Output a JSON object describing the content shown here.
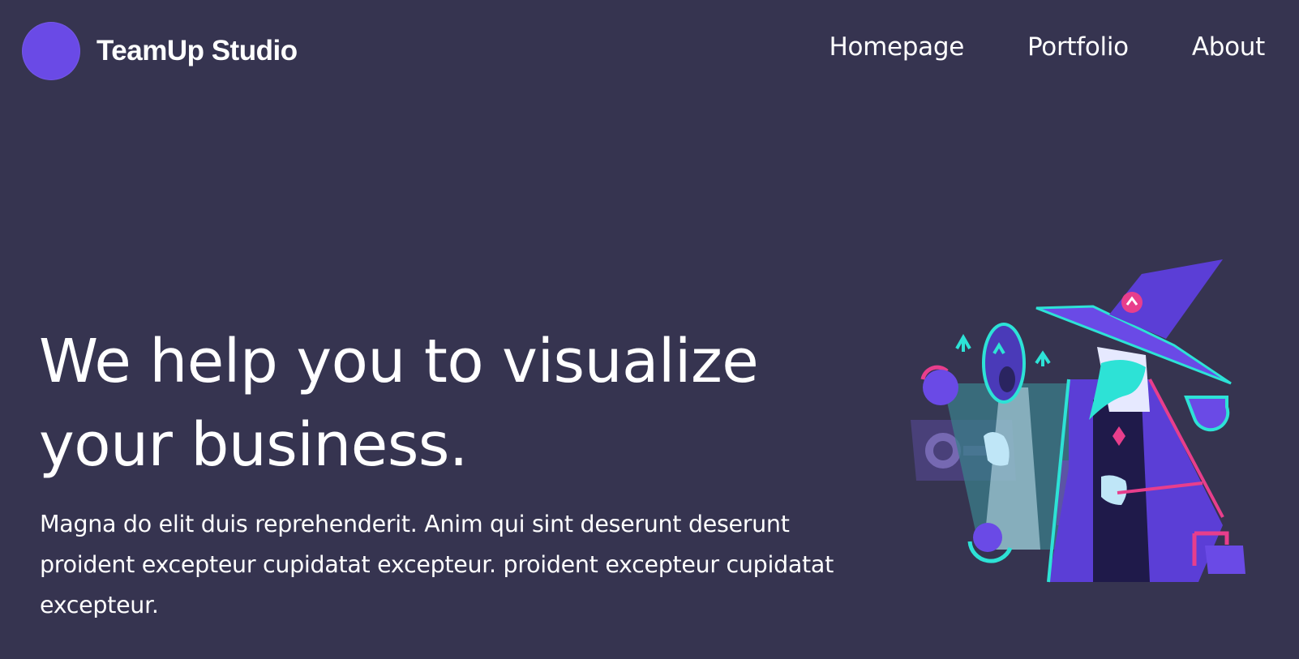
{
  "brand": {
    "name": "TeamUp Studio",
    "logo_color": "#6a4ae6"
  },
  "nav": {
    "items": [
      {
        "label": "Homepage"
      },
      {
        "label": "Portfolio"
      },
      {
        "label": "About"
      }
    ]
  },
  "hero": {
    "title_line1": "We help you to visualize",
    "title_line2": "your business.",
    "description": "Magna do elit duis reprehenderit. Anim qui sint deserunt deserunt proident excepteur cupidatat excepteur. proident excepteur cupidatat excepteur.",
    "illustration": "wizard-illustration"
  },
  "colors": {
    "background": "#363450",
    "accent_purple": "#6a4ae6",
    "accent_cyan": "#2de2d6",
    "accent_pink": "#e83e8c"
  }
}
